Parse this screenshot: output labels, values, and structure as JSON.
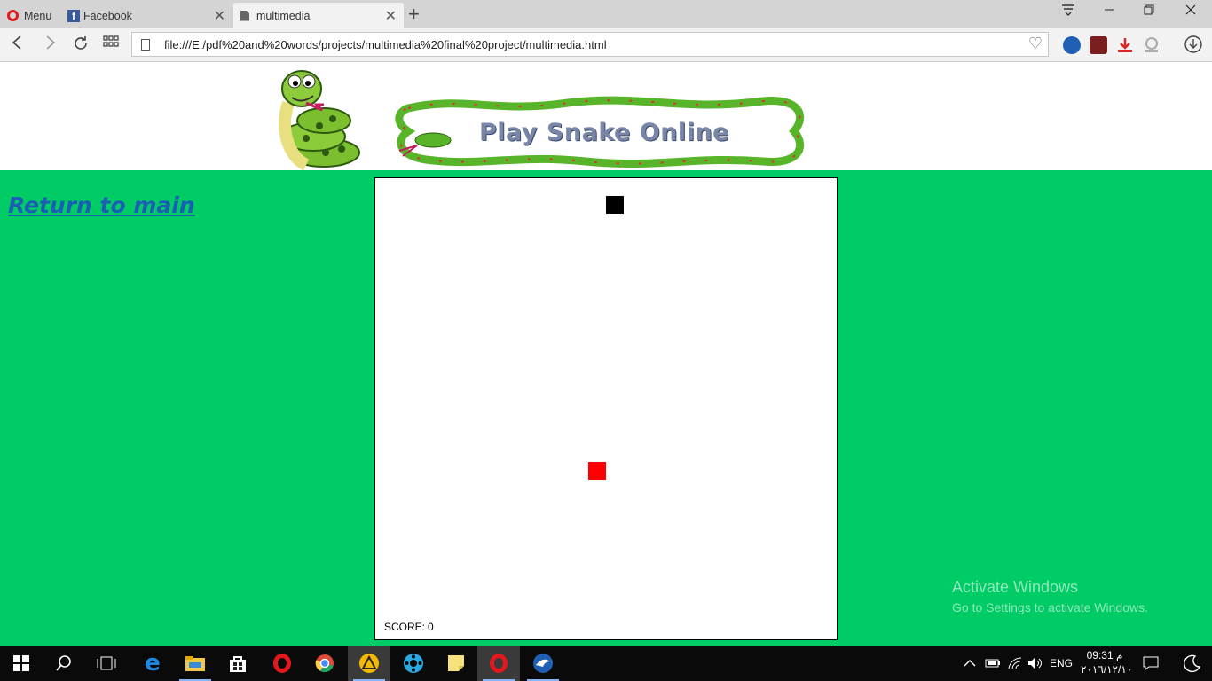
{
  "browser": {
    "menu_label": "Menu",
    "tabs": [
      {
        "title": "Facebook",
        "icon": "facebook-icon"
      },
      {
        "title": "multimedia",
        "icon": "document-icon",
        "active": true
      }
    ],
    "url": "file:///E:/pdf%20and%20words/projects/multimedia%20final%20project/multimedia.html"
  },
  "page": {
    "banner_title": "Play Snake Online",
    "return_link": "Return to main",
    "background_color": "#00cc66"
  },
  "game": {
    "score_label": "SCORE:",
    "score_value": "0",
    "snake_color": "#000000",
    "food_color": "#ff0000"
  },
  "watermark": {
    "title": "Activate Windows",
    "subtitle": "Go to Settings to activate Windows."
  },
  "taskbar": {
    "language": "ENG",
    "time": "09:31 م",
    "date": "٢٠١٦/١٢/١٠"
  }
}
